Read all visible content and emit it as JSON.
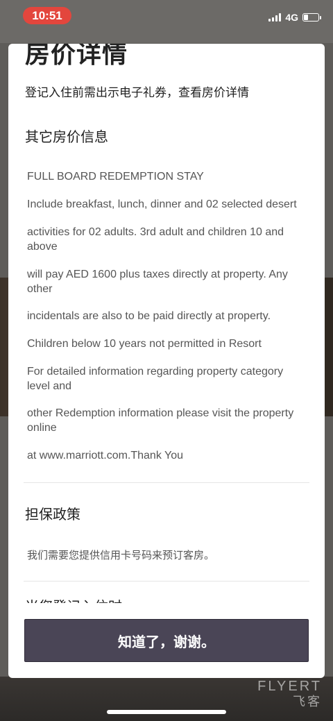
{
  "status_bar": {
    "time": "10:51",
    "network": "4G"
  },
  "modal": {
    "title": "房价详情",
    "subtitle": "登记入住前需出示电子礼券，查看房价详情",
    "sections": {
      "other_rate_info": {
        "heading": "其它房价信息",
        "paragraphs": [
          "FULL BOARD REDEMPTION STAY",
          "Include breakfast, lunch, dinner and 02 selected desert",
          "activities for 02 adults. 3rd adult and children 10 and above",
          "will pay AED 1600 plus taxes directly at property.   Any other",
          "incidentals are also to be paid directly at property.",
          "Children below 10 years not permitted in Resort",
          "For detailed information regarding property category level and",
          "other Redemption information please visit the property online",
          "at www.marriott.com.Thank You"
        ]
      },
      "guarantee_policy": {
        "heading": "担保政策",
        "text": "我们需要您提供信用卡号码来预订客房。"
      },
      "checkin_partial": {
        "heading": "当您登记入住时"
      }
    },
    "confirm_button": "知道了，谢谢。"
  },
  "watermark": {
    "text": "FLYERT",
    "sub": "飞客"
  }
}
